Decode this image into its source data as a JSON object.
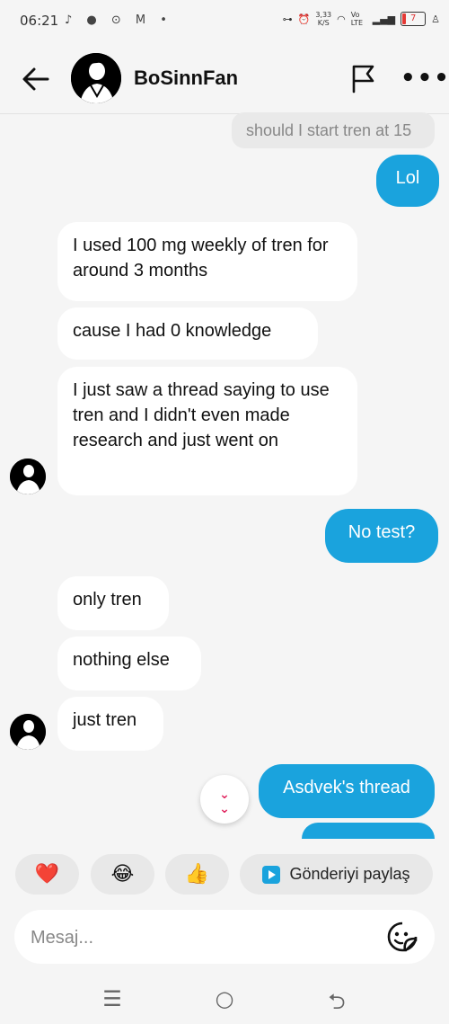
{
  "status_bar": {
    "time": "06:21",
    "app_icons": "♪ ● ⊙ M •",
    "speed_value": "3,33",
    "speed_unit": "K/S",
    "network": "Vo LTE",
    "battery": "7"
  },
  "header": {
    "contact_name": "BoSinnFan"
  },
  "messages": {
    "quoted": "should I start tren at 15",
    "m1": "Lol",
    "m2": "I used 100 mg weekly of tren for around 3 months",
    "m3": "cause I had 0 knowledge",
    "m4": "I just saw a thread saying to use tren and I didn't even made research and just went on",
    "m5": "No test?",
    "m6": "only tren",
    "m7": "nothing else",
    "m8": "just tren",
    "m9": "Asdvek's thread"
  },
  "quick_reactions": {
    "heart": "❤️",
    "laugh": "😂",
    "thumbs": "👍",
    "share_label": "Gönderiyi paylaş"
  },
  "composer": {
    "placeholder": "Mesaj..."
  },
  "colors": {
    "outgoing_bubble": "#1aa3dd",
    "incoming_bubble": "#ffffff",
    "background": "#f5f5f5"
  }
}
